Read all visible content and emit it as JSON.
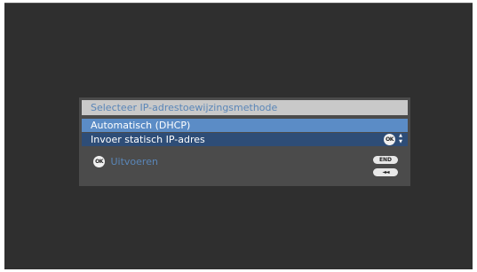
{
  "dialog": {
    "title": "Selecteer IP-adrestoewijzingsmethode",
    "items": [
      {
        "label": "Automatisch (DHCP)",
        "state": "focused"
      },
      {
        "label": "Invoer statisch IP-adres",
        "state": "normal"
      }
    ],
    "ok_icon": "OK",
    "updown_icon": "up-down-arrows-icon",
    "execute_label": "Uitvoeren",
    "end_button": "END",
    "back_button": "◄◄"
  },
  "colors": {
    "background": "#2f2f2f",
    "dialog": "#4b4b4b",
    "title_bar": "#c9c9c9",
    "accent_text": "#5a86b8",
    "focused_item": "#5b8cc6",
    "unfocused_item": "#2e4d77"
  }
}
